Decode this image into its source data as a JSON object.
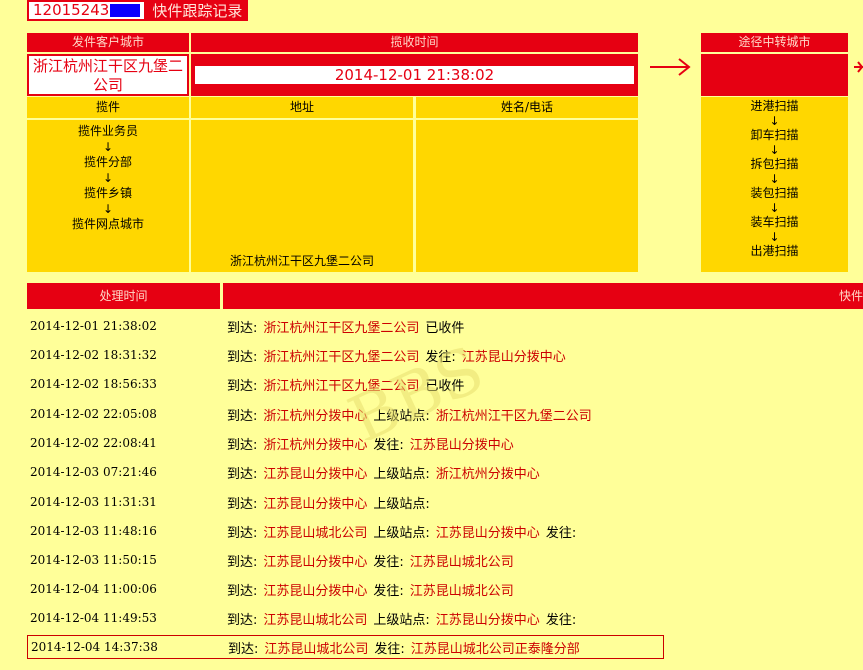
{
  "header": {
    "tracking_number_visible": "12015243",
    "title": "快件跟踪记录"
  },
  "summary": {
    "sender_city_label": "发件客户城市",
    "sender_city_value": "浙江杭州江干区九堡二公司",
    "pickup_time_label": "揽收时间",
    "pickup_time_value": "2014-12-01 21:38:02",
    "transit_city_label": "途径中转城市",
    "pickup_col_label": "揽件",
    "address_col_label": "地址",
    "name_phone_col_label": "姓名/电话",
    "pickup_steps": [
      "揽件业务员",
      "揽件分部",
      "揽件乡镇",
      "揽件网点城市"
    ],
    "address_value": "浙江杭州江干区九堡二公司",
    "transit_steps": [
      "进港扫描",
      "卸车扫描",
      "拆包扫描",
      "装包扫描",
      "装车扫描",
      "出港扫描"
    ],
    "step_arrow": "↓"
  },
  "process": {
    "time_header": "处理时间",
    "detail_header": "快件",
    "rows": [
      {
        "time": "2014-12-01 21:38:02",
        "parts": [
          [
            "到达:",
            "k"
          ],
          [
            "浙江杭州江干区九堡二公司",
            "r"
          ],
          [
            "已收件",
            "k"
          ]
        ]
      },
      {
        "time": "2014-12-02 18:31:32",
        "parts": [
          [
            "到达:",
            "k"
          ],
          [
            "浙江杭州江干区九堡二公司",
            "r"
          ],
          [
            "发往:",
            "k"
          ],
          [
            "江苏昆山分拨中心",
            "r"
          ]
        ]
      },
      {
        "time": "2014-12-02 18:56:33",
        "parts": [
          [
            "到达:",
            "k"
          ],
          [
            "浙江杭州江干区九堡二公司",
            "r"
          ],
          [
            "已收件",
            "k"
          ]
        ]
      },
      {
        "time": "2014-12-02 22:05:08",
        "parts": [
          [
            "到达:",
            "k"
          ],
          [
            "浙江杭州分拨中心",
            "r"
          ],
          [
            "上级站点:",
            "k"
          ],
          [
            "浙江杭州江干区九堡二公司",
            "r"
          ]
        ]
      },
      {
        "time": "2014-12-02 22:08:41",
        "parts": [
          [
            "到达:",
            "k"
          ],
          [
            "浙江杭州分拨中心",
            "r"
          ],
          [
            "发往:",
            "k"
          ],
          [
            "江苏昆山分拨中心",
            "r"
          ]
        ]
      },
      {
        "time": "2014-12-03 07:21:46",
        "parts": [
          [
            "到达:",
            "k"
          ],
          [
            "江苏昆山分拨中心",
            "r"
          ],
          [
            "上级站点:",
            "k"
          ],
          [
            "浙江杭州分拨中心",
            "r"
          ]
        ]
      },
      {
        "time": "2014-12-03 11:31:31",
        "parts": [
          [
            "到达:",
            "k"
          ],
          [
            "江苏昆山分拨中心",
            "r"
          ],
          [
            "上级站点:",
            "k"
          ]
        ]
      },
      {
        "time": "2014-12-03 11:48:16",
        "parts": [
          [
            "到达:",
            "k"
          ],
          [
            "江苏昆山城北公司",
            "r"
          ],
          [
            "上级站点:",
            "k"
          ],
          [
            "江苏昆山分拨中心",
            "r"
          ],
          [
            "发往:",
            "k"
          ]
        ]
      },
      {
        "time": "2014-12-03 11:50:15",
        "parts": [
          [
            "到达:",
            "k"
          ],
          [
            "江苏昆山分拨中心",
            "r"
          ],
          [
            "发往:",
            "k"
          ],
          [
            "江苏昆山城北公司",
            "r"
          ]
        ]
      },
      {
        "time": "2014-12-04 11:00:06",
        "parts": [
          [
            "到达:",
            "k"
          ],
          [
            "江苏昆山分拨中心",
            "r"
          ],
          [
            "发往:",
            "k"
          ],
          [
            "江苏昆山城北公司",
            "r"
          ]
        ]
      },
      {
        "time": "2014-12-04 11:49:53",
        "parts": [
          [
            "到达:",
            "k"
          ],
          [
            "江苏昆山城北公司",
            "r"
          ],
          [
            "上级站点:",
            "k"
          ],
          [
            "江苏昆山分拨中心",
            "r"
          ],
          [
            "发往:",
            "k"
          ]
        ]
      },
      {
        "time": "2014-12-04 14:37:38",
        "parts": [
          [
            "到达:",
            "k"
          ],
          [
            "江苏昆山城北公司",
            "r"
          ],
          [
            "发往:",
            "k"
          ],
          [
            "江苏昆山城北公司正泰隆分部",
            "r"
          ]
        ]
      }
    ]
  },
  "colors": {
    "background": "#ffff99",
    "header_red": "#e60012",
    "panel_yellow": "#ffd700",
    "text_red": "#cc0000"
  }
}
